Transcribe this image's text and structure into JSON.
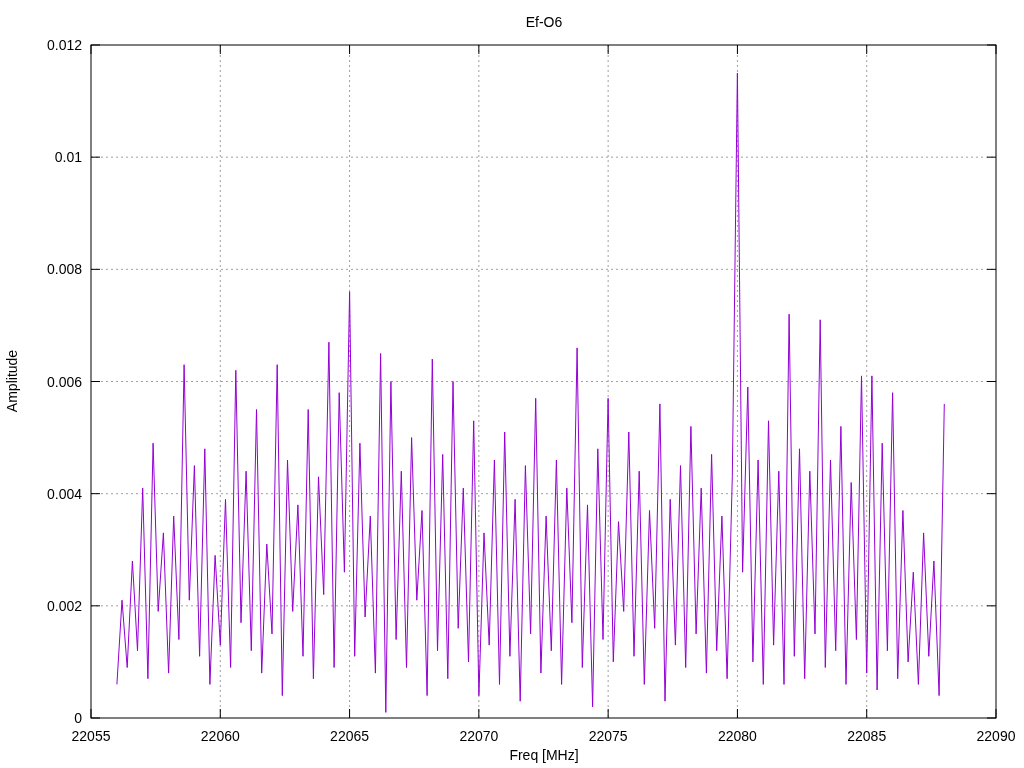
{
  "chart_data": {
    "type": "line",
    "title": "Ef-O6",
    "xlabel": "Freq [MHz]",
    "ylabel": "Amplitude",
    "xlim": [
      22055,
      22090
    ],
    "ylim": [
      0,
      0.012
    ],
    "grid": true,
    "xticks": [
      22055,
      22060,
      22065,
      22070,
      22075,
      22080,
      22085,
      22090
    ],
    "yticks": [
      {
        "value": 0,
        "label": "0"
      },
      {
        "value": 0.002,
        "label": "0.002"
      },
      {
        "value": 0.004,
        "label": "0.004"
      },
      {
        "value": 0.006,
        "label": "0.006"
      },
      {
        "value": 0.008,
        "label": "0.008"
      },
      {
        "value": 0.01,
        "label": "0.01"
      },
      {
        "value": 0.012,
        "label": "0.012"
      }
    ],
    "x": [
      22056,
      22056.2,
      22056.4,
      22056.6,
      22056.8,
      22057,
      22057.2,
      22057.4,
      22057.6,
      22057.8,
      22058,
      22058.2,
      22058.4,
      22058.6,
      22058.8,
      22059,
      22059.2,
      22059.4,
      22059.6,
      22059.8,
      22060,
      22060.2,
      22060.4,
      22060.6,
      22060.8,
      22061,
      22061.2,
      22061.4,
      22061.6,
      22061.8,
      22062,
      22062.2,
      22062.4,
      22062.6,
      22062.8,
      22063,
      22063.2,
      22063.4,
      22063.6,
      22063.8,
      22064,
      22064.2,
      22064.4,
      22064.6,
      22064.8,
      22065,
      22065.2,
      22065.4,
      22065.6,
      22065.8,
      22066,
      22066.2,
      22066.4,
      22066.6,
      22066.8,
      22067,
      22067.2,
      22067.4,
      22067.6,
      22067.8,
      22068,
      22068.2,
      22068.4,
      22068.6,
      22068.8,
      22069,
      22069.2,
      22069.4,
      22069.6,
      22069.8,
      22070,
      22070.2,
      22070.4,
      22070.6,
      22070.8,
      22071,
      22071.2,
      22071.4,
      22071.6,
      22071.8,
      22072,
      22072.2,
      22072.4,
      22072.6,
      22072.8,
      22073,
      22073.2,
      22073.4,
      22073.6,
      22073.8,
      22074,
      22074.2,
      22074.4,
      22074.6,
      22074.8,
      22075,
      22075.2,
      22075.4,
      22075.6,
      22075.8,
      22076,
      22076.2,
      22076.4,
      22076.6,
      22076.8,
      22077,
      22077.2,
      22077.4,
      22077.6,
      22077.8,
      22078,
      22078.2,
      22078.4,
      22078.6,
      22078.8,
      22079,
      22079.2,
      22079.4,
      22079.6,
      22079.8,
      22080,
      22080.2,
      22080.4,
      22080.6,
      22080.8,
      22081,
      22081.2,
      22081.4,
      22081.6,
      22081.8,
      22082,
      22082.2,
      22082.4,
      22082.6,
      22082.8,
      22083,
      22083.2,
      22083.4,
      22083.6,
      22083.8,
      22084,
      22084.2,
      22084.4,
      22084.6,
      22084.8,
      22085,
      22085.2,
      22085.4,
      22085.6,
      22085.8,
      22086,
      22086.2,
      22086.4,
      22086.6,
      22086.8,
      22087,
      22087.2,
      22087.4,
      22087.6,
      22087.8,
      22088
    ],
    "series": [
      {
        "color": "#9400d3",
        "values": [
          0.0006,
          0.0021,
          0.0009,
          0.0028,
          0.0012,
          0.0041,
          0.0007,
          0.0049,
          0.0019,
          0.0033,
          0.0008,
          0.0036,
          0.0014,
          0.0063,
          0.0021,
          0.0045,
          0.0011,
          0.0048,
          0.0006,
          0.0029,
          0.0013,
          0.0039,
          0.0009,
          0.0062,
          0.0017,
          0.0044,
          0.0012,
          0.0055,
          0.0008,
          0.0031,
          0.0015,
          0.0063,
          0.0004,
          0.0046,
          0.0019,
          0.0038,
          0.0011,
          0.0055,
          0.0007,
          0.0043,
          0.0022,
          0.0067,
          0.0009,
          0.0058,
          0.0026,
          0.0076,
          0.0011,
          0.0049,
          0.0018,
          0.0036,
          0.0008,
          0.0065,
          0.0001,
          0.006,
          0.0014,
          0.0044,
          0.0009,
          0.005,
          0.0021,
          0.0037,
          0.0004,
          0.0064,
          0.0012,
          0.0047,
          0.0007,
          0.006,
          0.0016,
          0.0041,
          0.001,
          0.0053,
          0.0004,
          0.0033,
          0.0013,
          0.0046,
          0.0006,
          0.0051,
          0.0011,
          0.0039,
          0.0003,
          0.0045,
          0.0015,
          0.0057,
          0.0008,
          0.0036,
          0.0012,
          0.0046,
          0.0006,
          0.0041,
          0.0017,
          0.0066,
          0.0009,
          0.0038,
          0.0002,
          0.0048,
          0.0014,
          0.0057,
          0.001,
          0.0035,
          0.0019,
          0.0051,
          0.0011,
          0.0044,
          0.0006,
          0.0037,
          0.0016,
          0.0056,
          0.0003,
          0.0039,
          0.0013,
          0.0045,
          0.0009,
          0.0052,
          0.0015,
          0.0041,
          0.0008,
          0.0047,
          0.0012,
          0.0036,
          0.0007,
          0.0043,
          0.0115,
          0.0026,
          0.0059,
          0.001,
          0.0046,
          0.0006,
          0.0053,
          0.0013,
          0.0044,
          0.0006,
          0.0072,
          0.0011,
          0.0048,
          0.0007,
          0.0044,
          0.0015,
          0.0071,
          0.0009,
          0.0046,
          0.0012,
          0.0052,
          0.0006,
          0.0042,
          0.0014,
          0.0061,
          0.0008,
          0.0061,
          0.0005,
          0.0049,
          0.0012,
          0.0058,
          0.0007,
          0.0037,
          0.001,
          0.0026,
          0.0006,
          0.0033,
          0.0011,
          0.0028,
          0.0004,
          0.0056
        ]
      }
    ]
  }
}
